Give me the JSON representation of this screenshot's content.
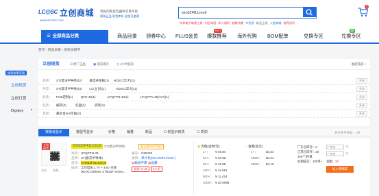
{
  "header": {
    "logo_main": "立创商城",
    "logo_sub": "LC@SC",
    "logo_url": "WWW.SZLCSC.COM",
    "slogan1": "领先的现货元器件交易平台",
    "slogan2": "原装正品  现货库存  全程可追溯",
    "search_value": "stm32f411ceu6",
    "hot_links": [
      "华邦电子电源上新",
      "村田电容",
      "新人福利",
      "超级特惠",
      "TI优选",
      "新品上线",
      "入驻商城",
      "推荐返利"
    ],
    "cart_count": "0",
    "colors": {
      "brand": "#1f6ae0",
      "accent": "#e53935"
    }
  },
  "nav": {
    "all_categories": "全部商品分类",
    "items": [
      "商品目录",
      "领券中心",
      "PLUS会员",
      "爆款推荐",
      "海外代购",
      "BOM配单",
      "兑换专区"
    ],
    "badges": {
      "hot": "HOT",
      "new": "新"
    }
  },
  "breadcrumb": [
    "首页",
    "商品目录",
    "搜索关键字"
  ],
  "sidebar": {
    "badge": "搜索结果范围",
    "items": [
      "立创现货",
      "立创订货",
      "Digikey"
    ]
  },
  "brand_bar": {
    "title": "立创现货",
    "opt1": "原厂正品",
    "opt2": "现货库存",
    "opt3": "4小时发货",
    "collapse": "收起筛选"
  },
  "filters": [
    {
      "label": "品牌：",
      "values": [
        "ST(意法半导体)(2)",
        "备案开发板(1)",
        "HDSC(华大)(1)"
      ],
      "more": "多选"
    },
    {
      "label": "供应：",
      "values": [
        "ST(意法半导体)(4)",
        "LC(立创)(1)",
        "HDSC(华大)(1)"
      ],
      "more": "多选"
    },
    {
      "label": "封装：",
      "values": [
        "PCB定制(1)",
        "QFN-48(1)",
        "UFQFPN-48(1)",
        "UFQFPN-48(7x7)(1)"
      ],
      "more": "多选"
    },
    {
      "label": "包装：",
      "values": [
        "编带(2)",
        "托盘(1)",
        "袋装(1)"
      ],
      "more": "多选"
    },
    {
      "label": "其他：",
      "values": [
        "最近含smt可贴(2)"
      ],
      "more": "多选"
    }
  ],
  "tabs": {
    "t1": "按渠道显示",
    "t2": "按型号显示",
    "s1": "价格",
    "s2": "销量",
    "s3": "新品",
    "cb1": "仅显示有货",
    "cb2": "折扣",
    "count": "共有条件商品：1条"
  },
  "product": {
    "tag1": "立创",
    "tag2": "现货",
    "name": "STM32F411CEU6",
    "brand": "ST(意法半导体)",
    "promo": "晶立盈SMT可贴!",
    "package": "UFQFPN-48",
    "code": "C60420",
    "category": "单片机(MCU/MPU/SOC)",
    "datasheet": "数据手册",
    "mfr_no": "STM32F411CEU6",
    "desc": "工作电压:1.7V ~ 3.6V 主频(MAX):100MHz STM32F Series...",
    "spec_label": "描述：",
    "coupon1": "领券 21-20",
    "coupon2": "8.2 折",
    "price_header1": "内档(含税/元)",
    "price_header2": "香港(美元)",
    "cn_prices": [
      {
        "qty": "1+：",
        "price": "¥ 46.84"
      },
      {
        "qty": "10+：",
        "price": "¥ 40.96"
      },
      {
        "qty": "30+：",
        "price": "¥ 19.88"
      },
      {
        "qty": "100+：",
        "price": "¥ 11.616"
      },
      {
        "qty": "500+：",
        "price": "¥ 11.424"
      },
      {
        "qty": "1000+：",
        "price": "¥ 20.0088"
      }
    ],
    "hk_prices": [
      {
        "qty": "1+：",
        "price": "$4.34"
      },
      {
        "qty": "1560+：",
        "price": "$4.24"
      },
      {
        "qty": "2860+：",
        "price": "$4.16"
      }
    ],
    "stock_info": [
      "广东仓库存：0",
      "江苏仓库存：20",
      "260个/托盘",
      "近期成交：100单+"
    ],
    "qty_placeholder": "广东仓",
    "unit": "个",
    "total_label": "总额：",
    "total": "¥0",
    "buy_button": "加入购物车",
    "compare": "对比",
    "collect": "收藏"
  }
}
